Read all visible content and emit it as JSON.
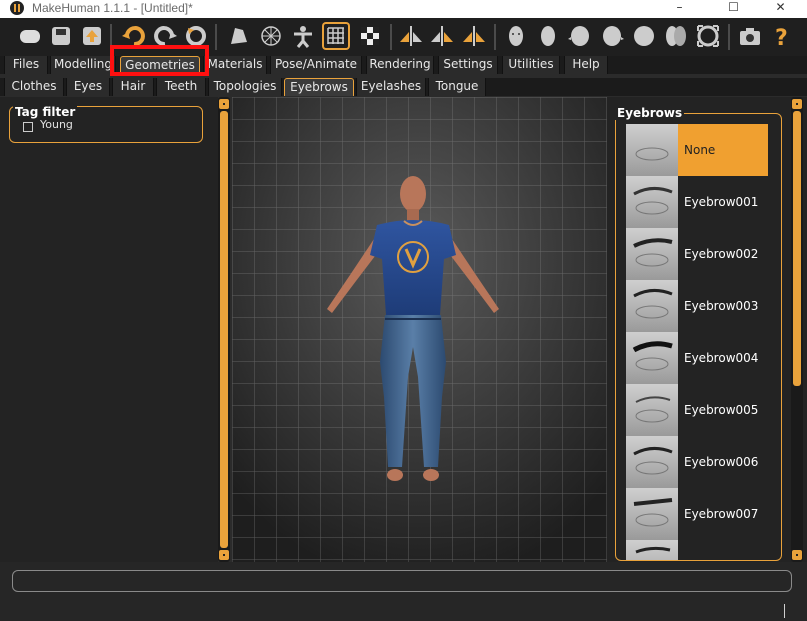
{
  "window": {
    "title": "MakeHuman 1.1.1 - [Untitled]*",
    "minimize": "–",
    "maximize": "☐",
    "close": "✕"
  },
  "toolbar": {
    "icons": [
      "shade-icon",
      "save-icon",
      "export-icon",
      "undo-icon",
      "redo-icon",
      "reset-icon",
      "smooth-icon",
      "wireframe-icon",
      "pose-icon",
      "grid-icon",
      "checker-icon",
      "symmetry-r-icon",
      "symmetry-l-icon",
      "symmetry-icon",
      "front-view-icon",
      "back-view-icon",
      "left-view-icon",
      "right-view-icon",
      "top-view-icon",
      "bottom-view-icon",
      "reset-camera-icon",
      "screenshot-icon",
      "help-icon"
    ]
  },
  "main_tabs": [
    "Files",
    "Modelling",
    "Geometries",
    "Materials",
    "Pose/Animate",
    "Rendering",
    "Settings",
    "Utilities",
    "Help"
  ],
  "sub_tabs": [
    "Clothes",
    "Eyes",
    "Hair",
    "Teeth",
    "Topologies",
    "Eyebrows",
    "Eyelashes",
    "Tongue"
  ],
  "selected_main": "Geometries",
  "selected_sub": "Eyebrows",
  "left": {
    "group_title": "Tag filter",
    "checkbox_label": "Young"
  },
  "right": {
    "title": "Eyebrows",
    "items": [
      "None",
      "Eyebrow001",
      "Eyebrow002",
      "Eyebrow003",
      "Eyebrow004",
      "Eyebrow005",
      "Eyebrow006",
      "Eyebrow007"
    ],
    "selected": "None"
  },
  "colors": {
    "accent": "#e9a23b",
    "highlight": "#ff1010"
  }
}
